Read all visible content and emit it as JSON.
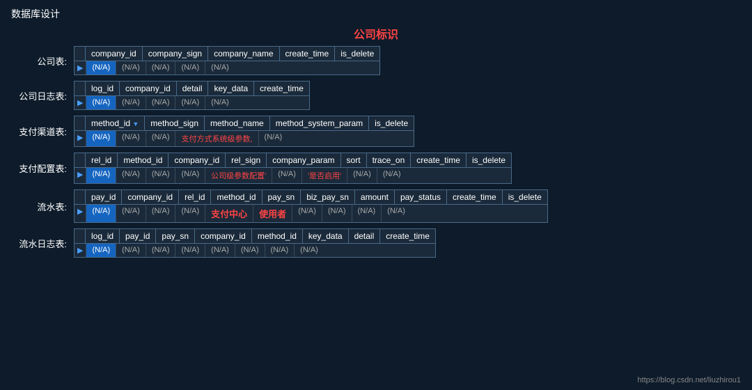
{
  "page": {
    "title": "数据库设计",
    "section_title": "公司标识",
    "bottom_link": "https://blog.csdn.net/liuzhirou1"
  },
  "tables": [
    {
      "label": "公司表:",
      "columns": [
        "company_id",
        "company_sign",
        "company_name",
        "create_time",
        "is_delete"
      ],
      "values": [
        "(N/A)",
        "(N/A)",
        "(N/A)",
        "(N/A)",
        "(N/A)"
      ],
      "highlighted": [
        0
      ],
      "special": []
    },
    {
      "label": "公司日志表:",
      "columns": [
        "log_id",
        "company_id",
        "detail",
        "key_data",
        "create_time"
      ],
      "values": [
        "(N/A)",
        "(N/A)",
        "(N/A)",
        "(N/A)",
        "(N/A)"
      ],
      "highlighted": [
        0
      ],
      "special": []
    },
    {
      "label": "支付渠道表:",
      "columns": [
        "method_id",
        "method_sign",
        "method_name",
        "method_system_param",
        "is_delete"
      ],
      "values": [
        "(N/A)",
        "(N/A)",
        "(N/A)",
        "支付方式系统级参数,",
        "(N/A)"
      ],
      "highlighted": [
        0
      ],
      "special": [
        3
      ]
    },
    {
      "label": "支付配置表:",
      "columns": [
        "rel_id",
        "method_id",
        "company_id",
        "rel_sign",
        "company_param",
        "sort",
        "trace_on",
        "create_time",
        "is_delete"
      ],
      "values": [
        "(N/A)",
        "(N/A)",
        "(N/A)",
        "(N/A)",
        "公司级参数配置'",
        "(N/A)",
        "'是否启用'",
        "(N/A)",
        "(N/A)"
      ],
      "highlighted": [
        0
      ],
      "special": [
        4,
        6
      ]
    },
    {
      "label": "流水表:",
      "columns": [
        "pay_id",
        "company_id",
        "rel_id",
        "method_id",
        "pay_sn",
        "biz_pay_sn",
        "amount",
        "pay_status",
        "create_time",
        "is_delete"
      ],
      "values": [
        "(N/A)",
        "(N/A)",
        "(N/A)",
        "(N/A)",
        "支付中心",
        "使用者",
        "(N/A)",
        "(N/A)",
        "(N/A)",
        "(N/A)"
      ],
      "highlighted": [
        0
      ],
      "special_paycenter": [
        4
      ],
      "special_user": [
        5
      ]
    },
    {
      "label": "流水日志表:",
      "columns": [
        "log_id",
        "pay_id",
        "pay_sn",
        "company_id",
        "method_id",
        "key_data",
        "detail",
        "create_time"
      ],
      "values": [
        "(N/A)",
        "(N/A)",
        "(N/A)",
        "(N/A)",
        "(N/A)",
        "(N/A)",
        "(N/A)",
        "(N/A)"
      ],
      "highlighted": [
        0
      ],
      "special": []
    }
  ]
}
